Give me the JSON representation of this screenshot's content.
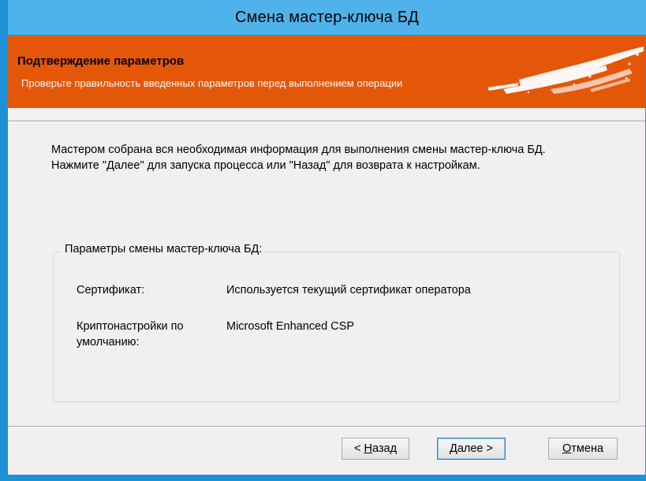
{
  "window": {
    "title": "Смена мастер-ключа БД"
  },
  "banner": {
    "title": "Подтверждение параметров",
    "subtitle": "Проверьте правильность введенных параметров перед выполнением операции"
  },
  "intro": {
    "text": "Мастером собрана вся необходимая информация для выполнения смены мастер-ключа БД. Нажмите \"Далее\" для запуска процесса или \"Назад\" для возврата к настройкам."
  },
  "params": {
    "group_label": "Параметры смены мастер-ключа БД:",
    "rows": [
      {
        "label": "Сертификат:",
        "value": "Используется текущий сертификат оператора"
      },
      {
        "label": "Криптонастройки по умолчанию:",
        "value": "Microsoft Enhanced CSP"
      }
    ]
  },
  "buttons": {
    "back": {
      "prefix": "< ",
      "mnemonic": "Н",
      "rest": "азад"
    },
    "next": {
      "mnemonic": "Д",
      "rest": "алее >"
    },
    "cancel": {
      "mnemonic": "О",
      "rest": "тмена"
    }
  },
  "colors": {
    "titlebar": "#4fb2ea",
    "frame": "#1e90d6",
    "banner": "#e45709",
    "client": "#f0f0f0"
  },
  "icons": {
    "banner_art": "white-brush-strokes-decoration"
  }
}
